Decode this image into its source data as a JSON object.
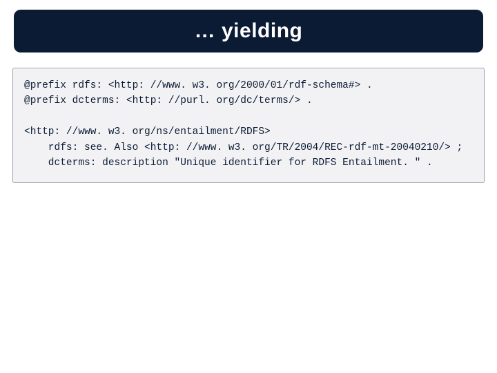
{
  "title": "… yielding",
  "code": {
    "line1": "@prefix rdfs: <http: //www. w3. org/2000/01/rdf-schema#> .",
    "line2": "@prefix dcterms: <http: //purl. org/dc/terms/> .",
    "line3": "<http: //www. w3. org/ns/entailment/RDFS>",
    "line4": "    rdfs: see. Also <http: //www. w3. org/TR/2004/REC-rdf-mt-20040210/> ;",
    "line5": "    dcterms: description \"Unique identifier for RDFS Entailment. \" ."
  }
}
